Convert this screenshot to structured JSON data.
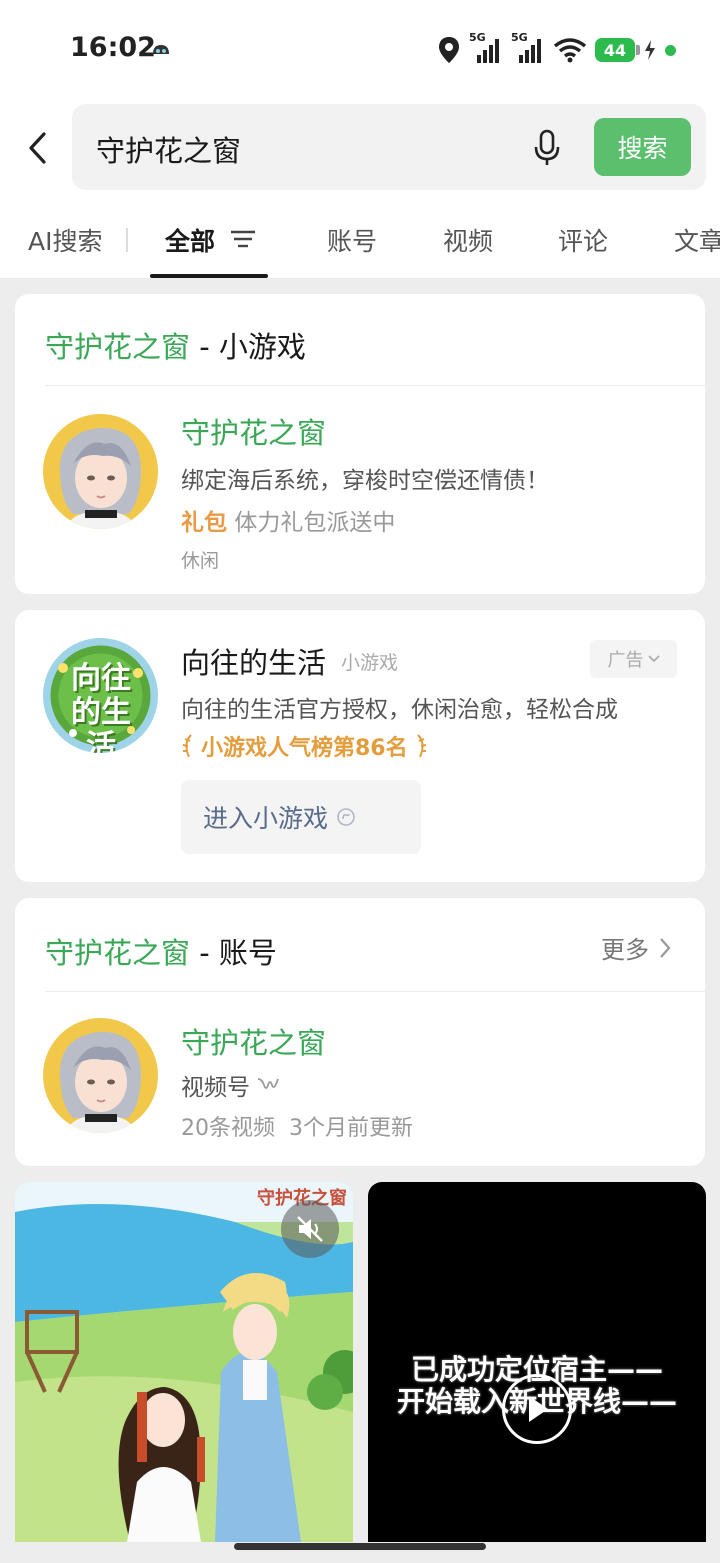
{
  "status": {
    "time": "16:02",
    "battery": "44",
    "sim1": "5G",
    "sim2": "5G"
  },
  "search": {
    "query": "守护花之窗",
    "button": "搜索"
  },
  "tabs": [
    "AI搜索",
    "全部",
    "账号",
    "视频",
    "评论",
    "文章"
  ],
  "game_card": {
    "header_keyword": "守护花之窗",
    "header_suffix": " - 小游戏",
    "title": "守护花之窗",
    "description": "绑定海后系统，穿梭时空偿还情债！",
    "gift_label": "礼包",
    "gift_desc": "体力礼包派送中",
    "category": "休闲"
  },
  "ad_card": {
    "title": "向往的生活",
    "subtitle": "小游戏",
    "badge": "广告",
    "description": "向往的生活官方授权，休闲治愈，轻松合成",
    "rank": "小游戏人气榜第86名",
    "enter_button": "进入小游戏",
    "logo_text": "向往的生活"
  },
  "account_card": {
    "header_keyword": "守护花之窗",
    "header_suffix": " - 账号",
    "more": "更多",
    "name": "守护花之窗",
    "type": "视频号",
    "video_count": "20条视频",
    "updated": "3个月前更新"
  },
  "videos": [
    {
      "watermark": "守护花之窗"
    },
    {
      "line1": "已成功定位宿主——",
      "line2": "开始载入新世界线——"
    }
  ],
  "colors": {
    "accent_green": "#3aa856",
    "button_green": "#5bbf6e",
    "gift_orange": "#e99a45",
    "link_blue": "#5b6b8c"
  }
}
